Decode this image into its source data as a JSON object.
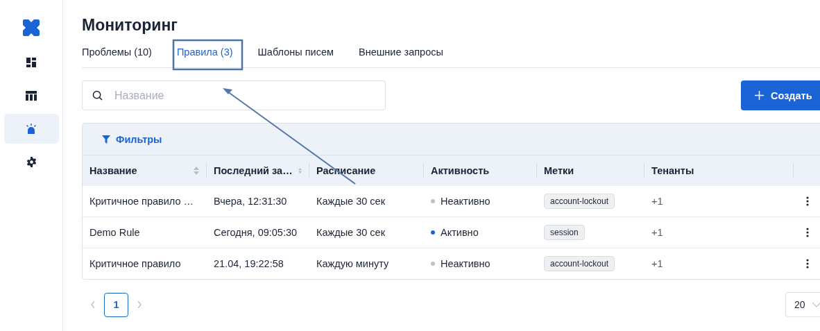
{
  "sidebar": {
    "items": [
      {
        "kind": "dashboard",
        "selected": false
      },
      {
        "kind": "table",
        "selected": false
      },
      {
        "kind": "alarm",
        "selected": true
      },
      {
        "kind": "settings",
        "selected": false
      }
    ]
  },
  "title": "Мониторинг",
  "tabs": [
    {
      "label": "Проблемы (10)",
      "selected": false
    },
    {
      "label": "Правила (3)",
      "selected": true
    },
    {
      "label": "Шаблоны писем",
      "selected": false
    },
    {
      "label": "Внешние запросы",
      "selected": false
    }
  ],
  "search": {
    "placeholder": "Название"
  },
  "create_button": "Создать",
  "filters_button": "Фильтры",
  "table": {
    "columns": [
      {
        "label": "Название",
        "sortable": true
      },
      {
        "label": "Последний за…",
        "sortable": true
      },
      {
        "label": "Расписание",
        "sortable": false
      },
      {
        "label": "Активность",
        "sortable": false
      },
      {
        "label": "Метки",
        "sortable": false
      },
      {
        "label": "Тенанты",
        "sortable": false
      }
    ],
    "rows": [
      {
        "name": "Критичное правило …",
        "last_run": "Вчера, 12:31:30",
        "schedule": "Каждые 30 сек",
        "status": "Неактивно",
        "active": false,
        "tag": "account-lockout",
        "tenants": "+1"
      },
      {
        "name": "Demo Rule",
        "last_run": "Сегодня, 09:05:30",
        "schedule": "Каждые 30 сек",
        "status": "Активно",
        "active": true,
        "tag": "session",
        "tenants": "+1"
      },
      {
        "name": "Критичное правило",
        "last_run": "21.04, 19:22:58",
        "schedule": "Каждую минуту",
        "status": "Неактивно",
        "active": false,
        "tag": "account-lockout",
        "tenants": "+1"
      }
    ]
  },
  "pagination": {
    "prev_disabled": true,
    "next_disabled": true,
    "pages": [
      {
        "label": "1",
        "selected": true
      }
    ],
    "page_size": "20"
  }
}
